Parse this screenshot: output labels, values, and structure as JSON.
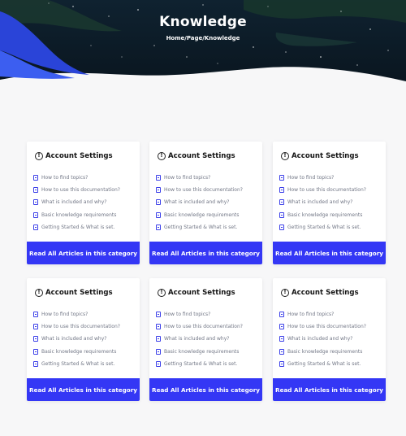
{
  "hero": {
    "title": "Knowledge",
    "breadcrumb": "Home/Page/Knowledge"
  },
  "colors": {
    "accent": "#3437f5",
    "hero_dark": "#0d1a26",
    "page_bg": "#f7f7f8"
  },
  "cards": [
    {
      "icon": "info-circle-icon",
      "title": "Account Settings",
      "articles": [
        "How to find topics?",
        "How to use this documentation?",
        "What is included and why?",
        "Basic knowledge requirements",
        "Getting Started & What is set."
      ],
      "button": "Read All Articles in this category"
    },
    {
      "icon": "info-circle-icon",
      "title": "Account Settings",
      "articles": [
        "How to find topics?",
        "How to use this documentation?",
        "What is included and why?",
        "Basic knowledge requirements",
        "Getting Started & What is set."
      ],
      "button": "Read All Articles in this category"
    },
    {
      "icon": "info-circle-icon",
      "title": "Account Settings",
      "articles": [
        "How to find topics?",
        "How to use this documentation?",
        "What is included and why?",
        "Basic knowledge requirements",
        "Getting Started & What is set."
      ],
      "button": "Read All Articles in this category"
    },
    {
      "icon": "info-circle-icon",
      "title": "Account Settings",
      "articles": [
        "How to find topics?",
        "How to use this documentation?",
        "What is included and why?",
        "Basic knowledge requirements",
        "Getting Started & What is set."
      ],
      "button": "Read All Articles in this category"
    },
    {
      "icon": "info-circle-icon",
      "title": "Account Settings",
      "articles": [
        "How to find topics?",
        "How to use this documentation?",
        "What is included and why?",
        "Basic knowledge requirements",
        "Getting Started & What is set."
      ],
      "button": "Read All Articles in this category"
    },
    {
      "icon": "info-circle-icon",
      "title": "Account Settings",
      "articles": [
        "How to find topics?",
        "How to use this documentation?",
        "What is included and why?",
        "Basic knowledge requirements",
        "Getting Started & What is set."
      ],
      "button": "Read All Articles in this category"
    }
  ]
}
